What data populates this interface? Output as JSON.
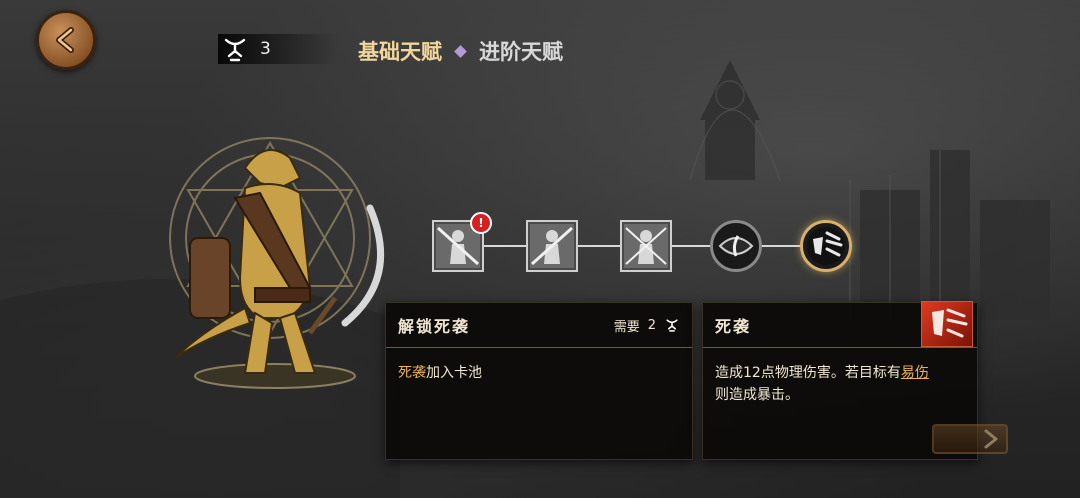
{
  "header": {
    "talent_points": "3",
    "tabs": [
      {
        "label": "基础天赋",
        "active": true
      },
      {
        "label": "进阶天赋",
        "active": false
      }
    ]
  },
  "talent_track": {
    "nodes": [
      {
        "icon": "character-silhouette-icon",
        "has_alert": true
      },
      {
        "icon": "character-silhouette-icon",
        "has_alert": false
      },
      {
        "icon": "character-silhouette-icon",
        "has_alert": false
      },
      {
        "icon": "eye-icon",
        "has_alert": false
      },
      {
        "icon": "death-strike-icon",
        "has_alert": false,
        "selected": true
      }
    ]
  },
  "unlock_panel": {
    "title": "解锁死袭",
    "requirement_label": "需要",
    "requirement_value": "2",
    "description_highlight": "死袭",
    "description_rest": "加入卡池"
  },
  "card_panel": {
    "title": "死袭",
    "description_part1": "造成12点物理伤害。若目标有",
    "description_link": "易伤",
    "description_part2": "则造成暴击。"
  },
  "colors": {
    "active_tab": "#f2d59a",
    "highlight": "#ecb35a",
    "alert": "#d42020"
  }
}
